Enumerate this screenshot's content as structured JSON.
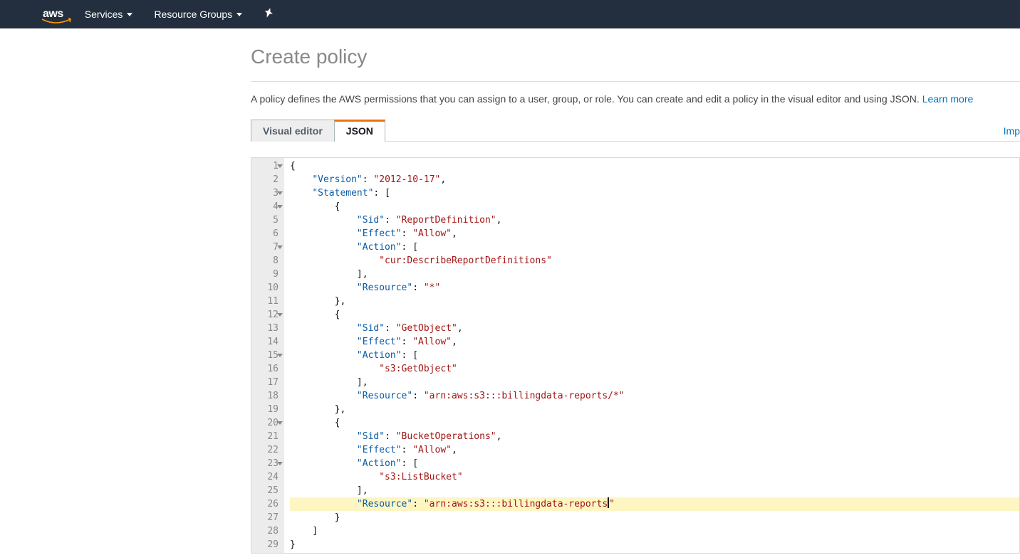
{
  "nav": {
    "logo_text": "aws",
    "services": "Services",
    "resource_groups": "Resource Groups"
  },
  "page": {
    "title": "Create policy",
    "description": "A policy defines the AWS permissions that you can assign to a user, group, or role. You can create and edit a policy in the visual editor and using JSON. ",
    "learn_more": "Learn more",
    "import_link": "Imp"
  },
  "tabs": {
    "visual": "Visual editor",
    "json": "JSON"
  },
  "editor": {
    "highlighted_line": 26,
    "fold_lines": [
      1,
      3,
      4,
      7,
      12,
      15,
      20,
      23
    ],
    "lines": [
      {
        "n": 1,
        "indent": 0,
        "segs": [
          {
            "t": "{",
            "c": "pun"
          }
        ]
      },
      {
        "n": 2,
        "indent": 1,
        "segs": [
          {
            "t": "\"Version\"",
            "c": "kw"
          },
          {
            "t": ": ",
            "c": "pun"
          },
          {
            "t": "\"2012-10-17\"",
            "c": "str"
          },
          {
            "t": ",",
            "c": "pun"
          }
        ]
      },
      {
        "n": 3,
        "indent": 1,
        "segs": [
          {
            "t": "\"Statement\"",
            "c": "kw"
          },
          {
            "t": ": [",
            "c": "pun"
          }
        ]
      },
      {
        "n": 4,
        "indent": 2,
        "segs": [
          {
            "t": "{",
            "c": "pun"
          }
        ]
      },
      {
        "n": 5,
        "indent": 3,
        "segs": [
          {
            "t": "\"Sid\"",
            "c": "kw"
          },
          {
            "t": ": ",
            "c": "pun"
          },
          {
            "t": "\"ReportDefinition\"",
            "c": "str"
          },
          {
            "t": ",",
            "c": "pun"
          }
        ]
      },
      {
        "n": 6,
        "indent": 3,
        "segs": [
          {
            "t": "\"Effect\"",
            "c": "kw"
          },
          {
            "t": ": ",
            "c": "pun"
          },
          {
            "t": "\"Allow\"",
            "c": "str"
          },
          {
            "t": ",",
            "c": "pun"
          }
        ]
      },
      {
        "n": 7,
        "indent": 3,
        "segs": [
          {
            "t": "\"Action\"",
            "c": "kw"
          },
          {
            "t": ": [",
            "c": "pun"
          }
        ]
      },
      {
        "n": 8,
        "indent": 4,
        "segs": [
          {
            "t": "\"cur:DescribeReportDefinitions\"",
            "c": "str"
          }
        ]
      },
      {
        "n": 9,
        "indent": 3,
        "segs": [
          {
            "t": "],",
            "c": "pun"
          }
        ]
      },
      {
        "n": 10,
        "indent": 3,
        "segs": [
          {
            "t": "\"Resource\"",
            "c": "kw"
          },
          {
            "t": ": ",
            "c": "pun"
          },
          {
            "t": "\"*\"",
            "c": "str"
          }
        ]
      },
      {
        "n": 11,
        "indent": 2,
        "segs": [
          {
            "t": "},",
            "c": "pun"
          }
        ]
      },
      {
        "n": 12,
        "indent": 2,
        "segs": [
          {
            "t": "{",
            "c": "pun"
          }
        ]
      },
      {
        "n": 13,
        "indent": 3,
        "segs": [
          {
            "t": "\"Sid\"",
            "c": "kw"
          },
          {
            "t": ": ",
            "c": "pun"
          },
          {
            "t": "\"GetObject\"",
            "c": "str"
          },
          {
            "t": ",",
            "c": "pun"
          }
        ]
      },
      {
        "n": 14,
        "indent": 3,
        "segs": [
          {
            "t": "\"Effect\"",
            "c": "kw"
          },
          {
            "t": ": ",
            "c": "pun"
          },
          {
            "t": "\"Allow\"",
            "c": "str"
          },
          {
            "t": ",",
            "c": "pun"
          }
        ]
      },
      {
        "n": 15,
        "indent": 3,
        "segs": [
          {
            "t": "\"Action\"",
            "c": "kw"
          },
          {
            "t": ": [",
            "c": "pun"
          }
        ]
      },
      {
        "n": 16,
        "indent": 4,
        "segs": [
          {
            "t": "\"s3:GetObject\"",
            "c": "str"
          }
        ]
      },
      {
        "n": 17,
        "indent": 3,
        "segs": [
          {
            "t": "],",
            "c": "pun"
          }
        ]
      },
      {
        "n": 18,
        "indent": 3,
        "segs": [
          {
            "t": "\"Resource\"",
            "c": "kw"
          },
          {
            "t": ": ",
            "c": "pun"
          },
          {
            "t": "\"arn:aws:s3:::billingdata-reports/*\"",
            "c": "str"
          }
        ]
      },
      {
        "n": 19,
        "indent": 2,
        "segs": [
          {
            "t": "},",
            "c": "pun"
          }
        ]
      },
      {
        "n": 20,
        "indent": 2,
        "segs": [
          {
            "t": "{",
            "c": "pun"
          }
        ]
      },
      {
        "n": 21,
        "indent": 3,
        "segs": [
          {
            "t": "\"Sid\"",
            "c": "kw"
          },
          {
            "t": ": ",
            "c": "pun"
          },
          {
            "t": "\"BucketOperations\"",
            "c": "str"
          },
          {
            "t": ",",
            "c": "pun"
          }
        ]
      },
      {
        "n": 22,
        "indent": 3,
        "segs": [
          {
            "t": "\"Effect\"",
            "c": "kw"
          },
          {
            "t": ": ",
            "c": "pun"
          },
          {
            "t": "\"Allow\"",
            "c": "str"
          },
          {
            "t": ",",
            "c": "pun"
          }
        ]
      },
      {
        "n": 23,
        "indent": 3,
        "segs": [
          {
            "t": "\"Action\"",
            "c": "kw"
          },
          {
            "t": ": [",
            "c": "pun"
          }
        ]
      },
      {
        "n": 24,
        "indent": 4,
        "segs": [
          {
            "t": "\"s3:ListBucket\"",
            "c": "str"
          }
        ]
      },
      {
        "n": 25,
        "indent": 3,
        "segs": [
          {
            "t": "],",
            "c": "pun"
          }
        ]
      },
      {
        "n": 26,
        "indent": 3,
        "segs": [
          {
            "t": "\"Resource\"",
            "c": "kw"
          },
          {
            "t": ": ",
            "c": "pun"
          },
          {
            "t": "\"arn:aws:s3:::billingdata-reports",
            "c": "str"
          },
          {
            "t": "CURSOR",
            "c": "cursor"
          },
          {
            "t": "\"",
            "c": "str"
          }
        ]
      },
      {
        "n": 27,
        "indent": 2,
        "segs": [
          {
            "t": "}",
            "c": "pun"
          }
        ]
      },
      {
        "n": 28,
        "indent": 1,
        "segs": [
          {
            "t": "]",
            "c": "pun"
          }
        ]
      },
      {
        "n": 29,
        "indent": 0,
        "segs": [
          {
            "t": "}",
            "c": "pun"
          }
        ]
      }
    ]
  }
}
